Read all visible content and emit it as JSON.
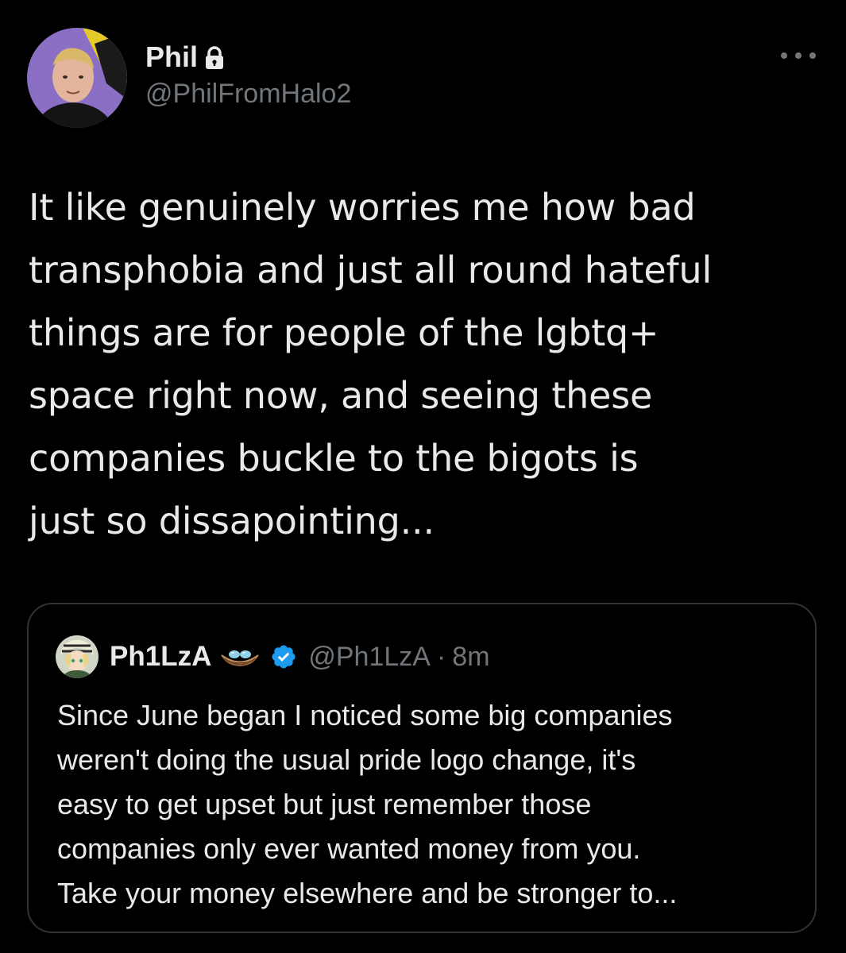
{
  "tweet": {
    "display_name": "Phil",
    "handle": "@PhilFromHalo2",
    "text": "It like genuinely worries me how bad\ntransphobia and just all round hateful\nthings are for people of the lgbtq+\nspace right now, and seeing these\ncompanies buckle to the bigots is\njust so dissapointing...",
    "icons": {
      "lock": "lock-icon",
      "more": "more-options-icon"
    }
  },
  "quote": {
    "display_name": "Ph1LzA",
    "handle": "@Ph1LzA",
    "separator": "·",
    "time": "8m",
    "text": "Since June began I noticed some big companies\nweren't doing the usual pride logo change, it's\neasy to get upset but just remember those\ncompanies only ever wanted money from you.\nTake your money elsewhere and be stronger to...",
    "icons": {
      "nest": "nest-emoji-icon",
      "verified": "verified-badge-icon"
    }
  },
  "colors": {
    "background": "#000000",
    "primary_text": "#e7e9ea",
    "secondary_text": "#71767b",
    "border": "#2f3336",
    "verified": "#1d9bf0"
  }
}
